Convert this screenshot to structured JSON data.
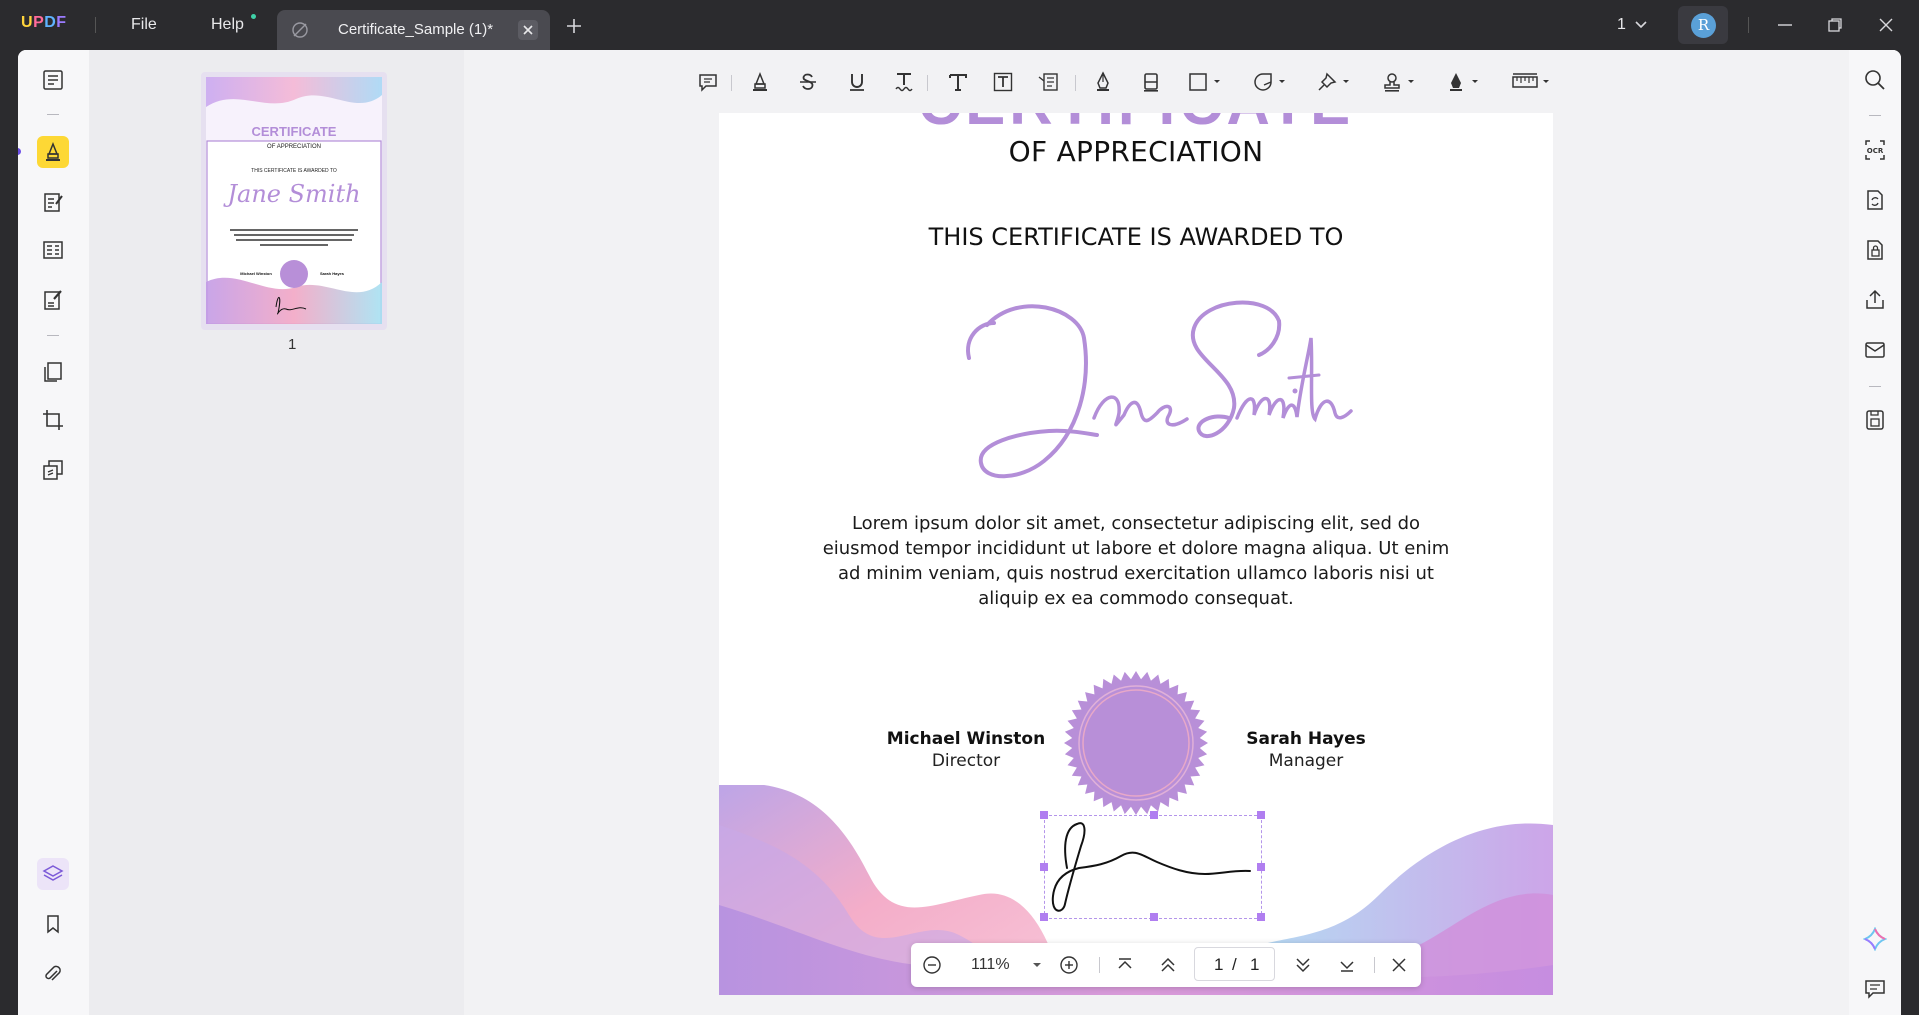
{
  "app": {
    "logo": "UPDF",
    "menu": {
      "file": "File",
      "help": "Help"
    },
    "tab_title": "Certificate_Sample (1)*",
    "page_selector": "1",
    "avatar_initial": "R"
  },
  "thumbnails": {
    "page_number": "1",
    "mini": {
      "title": "CERTIFICATE",
      "subtitle": "OF APPRECIATION",
      "awarded": "THIS CERTIFICATE IS AWARDED TO",
      "name_left": "Michael Winston",
      "name_right": "Sarah Hayes"
    }
  },
  "document": {
    "appreciation": "OF APPRECIATION",
    "awarded_to": "THIS CERTIFICATE IS AWARDED TO",
    "recipient": "Jane Smith",
    "body": "Lorem ipsum dolor sit amet, consectetur adipiscing elit, sed do eiusmod tempor incididunt ut labore et dolore magna aliqua. Ut enim ad minim veniam, quis nostrud exercitation ullamco laboris nisi ut aliquip ex ea commodo consequat.",
    "signer_left": {
      "name": "Michael Winston",
      "role": "Director"
    },
    "signer_right": {
      "name": "Sarah Hayes",
      "role": "Manager"
    }
  },
  "navigation": {
    "zoom": "111%",
    "current_page": "1",
    "separator": "/",
    "total_pages": "1"
  },
  "colors": {
    "accent_purple": "#b38ed8",
    "highlight_yellow": "#fdd835",
    "frame_bg": "#2b2b2e"
  }
}
